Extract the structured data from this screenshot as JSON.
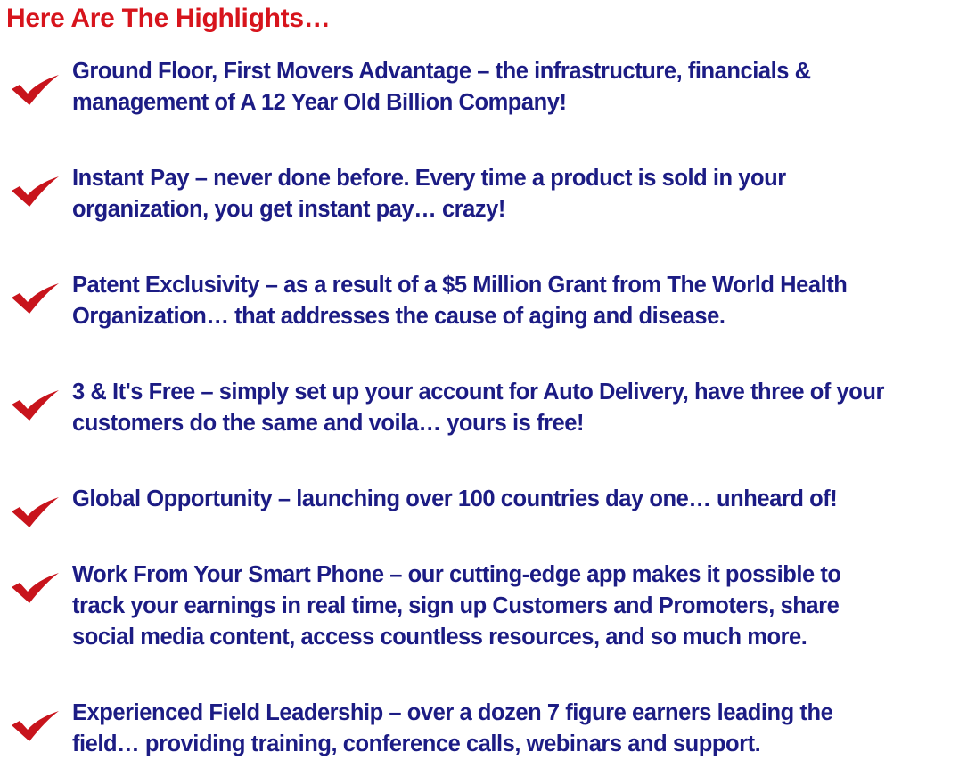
{
  "heading": "Here Are The Highlights…",
  "colors": {
    "heading": "#d7141c",
    "body_text": "#1c1c84",
    "checkmark": "#c8141c",
    "background": "#ffffff"
  },
  "check_icon": "red-checkmark-icon",
  "highlights": [
    {
      "lines": [
        "Ground Floor, First Movers Advantage – the infrastructure, financials &",
        "management of A 12 Year Old Billion Company!"
      ]
    },
    {
      "lines": [
        "Instant Pay – never done before. Every time a product is sold in your",
        "organization, you get instant pay… crazy!"
      ]
    },
    {
      "lines": [
        "Patent Exclusivity – as a result of a $5 Million Grant from The World Health",
        "Organization… that addresses the cause of aging and disease."
      ]
    },
    {
      "lines": [
        "3 & It's Free – simply set up your account for Auto Delivery, have three of your",
        "customers do the same and voila… yours is free!"
      ]
    },
    {
      "lines": [
        "Global Opportunity – launching over 100 countries day one… unheard of!"
      ]
    },
    {
      "lines": [
        "Work From Your Smart Phone – our cutting-edge app makes it possible to",
        "track your earnings in real time, sign up Customers and Promoters, share",
        "social media content, access countless resources, and so much more."
      ]
    },
    {
      "lines": [
        "Experienced Field Leadership – over a dozen 7 figure earners leading the",
        "field… providing training, conference calls, webinars and support."
      ]
    }
  ]
}
